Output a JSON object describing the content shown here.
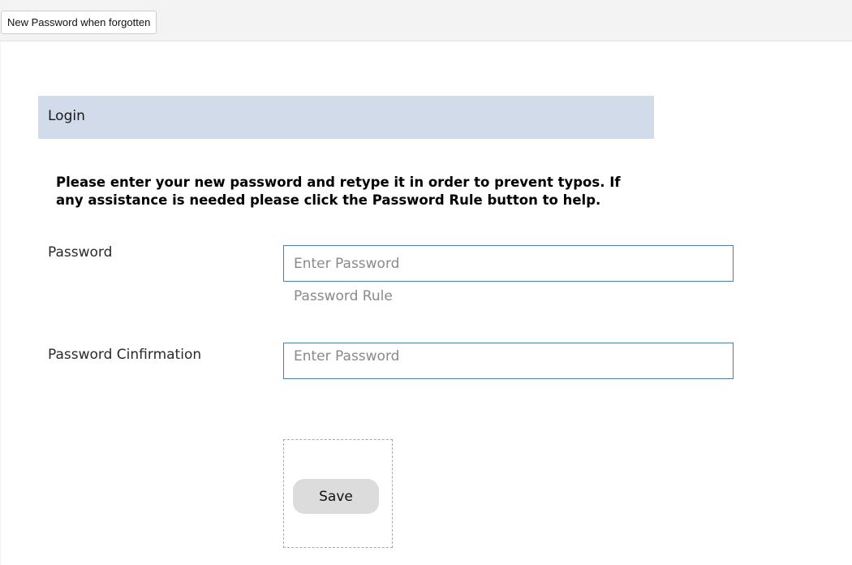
{
  "topbar": {
    "tab_label": "New Password when forgotten"
  },
  "section": {
    "title": "Login"
  },
  "instructions": "Please enter your new password and retype it in order to prevent typos. If any assistance is needed please click the Password Rule button to help.",
  "form": {
    "password": {
      "label": "Password",
      "value": "",
      "placeholder": "Enter Password",
      "rule_link": "Password Rule"
    },
    "confirmation": {
      "label": "Password Cinfirmation",
      "value": "",
      "placeholder": "Enter Password"
    },
    "save_label": "Save"
  },
  "colors": {
    "header_bg": "#d1dbea",
    "input_border": "#4e7ea8",
    "button_bg": "#dcdcdc"
  }
}
